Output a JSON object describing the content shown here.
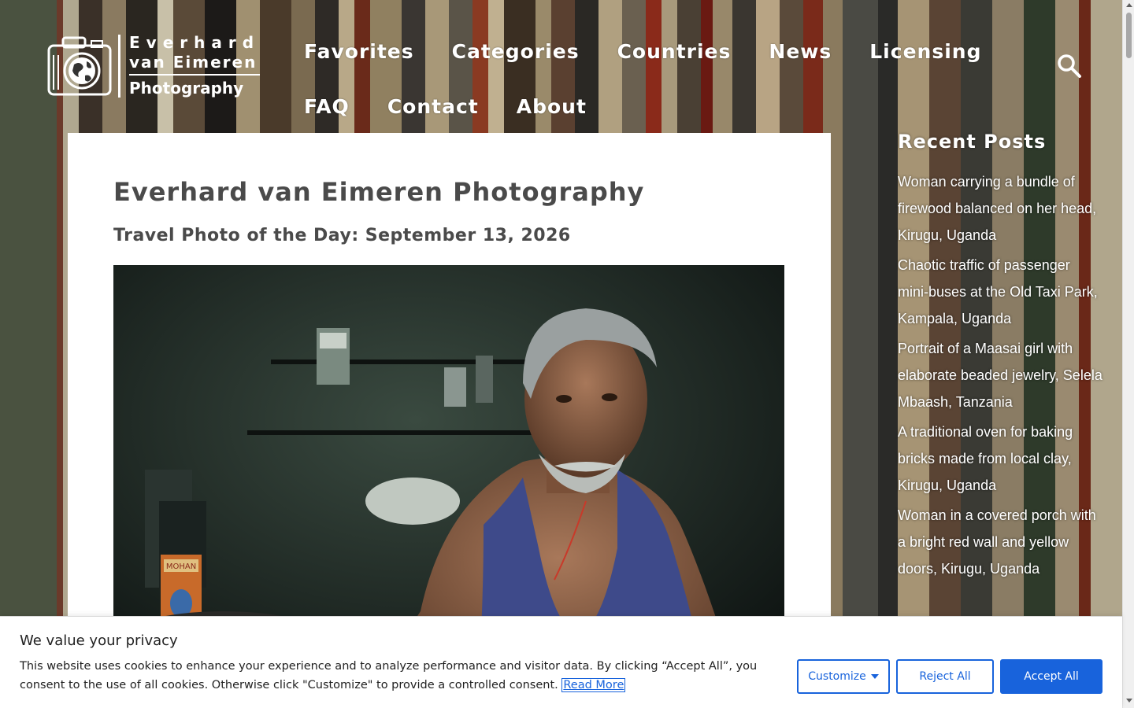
{
  "logo": {
    "line1": "Everhard",
    "line2": "van Eimeren",
    "line3": "Photography"
  },
  "nav": {
    "row1": [
      "Favorites",
      "Categories",
      "Countries",
      "News",
      "Licensing"
    ],
    "row2": [
      "FAQ",
      "Contact",
      "About"
    ]
  },
  "search": {
    "icon": "search-icon"
  },
  "main": {
    "page_title": "Everhard van Eimeren Photography",
    "post_title": "Travel Photo of the Day: September 13, 2026",
    "photo_label": "MOHAN"
  },
  "sidebar": {
    "title": "Recent Posts",
    "posts": [
      "Woman carrying a bundle of firewood balanced on her head, Kirugu, Uganda",
      "Chaotic traffic of passenger mini-buses at the Old Taxi Park, Kampala, Uganda",
      "Portrait of a Maasai girl with elaborate beaded jewelry, Selela Mbaash, Tanzania",
      "A traditional oven for baking bricks made from local clay, Kirugu, Uganda",
      "Woman in a covered porch with a bright red wall and yellow doors, Kirugu, Uganda"
    ]
  },
  "cookie": {
    "title": "We value your privacy",
    "text": "This website uses cookies to enhance your experience and to analyze performance and visitor data. By clicking “Accept All”, you consent to the use of all cookies. Otherwise click \"Customize\" to provide a controlled consent. ",
    "read_more": "Read More",
    "customize": "Customize",
    "reject": "Reject All",
    "accept": "Accept All"
  },
  "colors": {
    "accent": "#1863dc",
    "heading": "#4a4a4a"
  }
}
